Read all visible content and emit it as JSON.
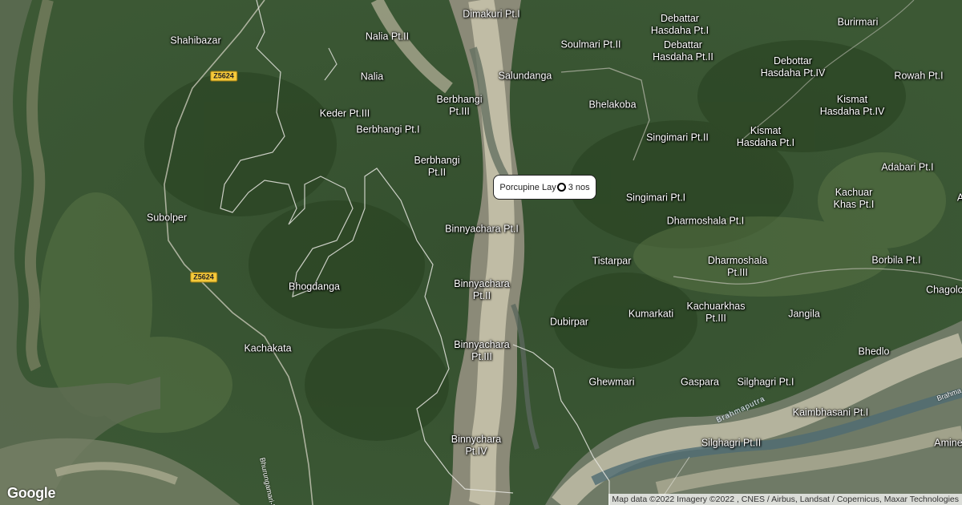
{
  "map": {
    "places": [
      {
        "key": "dimakuri",
        "label": "Dimakuri Pt.I"
      },
      {
        "key": "nalia_pt2",
        "label": "Nalia Pt.II"
      },
      {
        "key": "shahibazar",
        "label": "Shahibazar"
      },
      {
        "key": "soulmari",
        "label": "Soulmari Pt.II"
      },
      {
        "key": "debattar1",
        "label": "Debattar\nHasdaha Pt.I"
      },
      {
        "key": "debattar2",
        "label": "Debattar\nHasdaha Pt.II"
      },
      {
        "key": "burirmari",
        "label": "Burirmari"
      },
      {
        "key": "debottar4",
        "label": "Debottar\nHasdaha Pt.IV"
      },
      {
        "key": "nalia",
        "label": "Nalia"
      },
      {
        "key": "salundanga",
        "label": "Salundanga"
      },
      {
        "key": "rowah",
        "label": "Rowah Pt.I"
      },
      {
        "key": "bhelakoba",
        "label": "Bhelakoba"
      },
      {
        "key": "berbhangi3",
        "label": "Berbhangi\nPt.III"
      },
      {
        "key": "keder",
        "label": "Keder Pt.III"
      },
      {
        "key": "kismat4",
        "label": "Kismat\nHasdaha Pt.IV"
      },
      {
        "key": "berbhangi1",
        "label": "Berbhangi Pt.I"
      },
      {
        "key": "singimari2",
        "label": "Singimari Pt.II"
      },
      {
        "key": "kismat1",
        "label": "Kismat\nHasdaha Pt.I"
      },
      {
        "key": "berbhangi2",
        "label": "Berbhangi\nPt.II"
      },
      {
        "key": "adabari",
        "label": "Adabari Pt.I"
      },
      {
        "key": "singimari1",
        "label": "Singimari Pt.I"
      },
      {
        "key": "kachuar",
        "label": "Kachuar\nKhas Pt.I"
      },
      {
        "key": "subolper",
        "label": "Subolper"
      },
      {
        "key": "dharmoshala1",
        "label": "Dharmoshala Pt.I"
      },
      {
        "key": "binnyachara1",
        "label": "Binnyachara Pt.I"
      },
      {
        "key": "tistarpar",
        "label": "Tistarpar"
      },
      {
        "key": "dharmoshala3",
        "label": "Dharmoshala\nPt.III"
      },
      {
        "key": "borbila",
        "label": "Borbila Pt.I"
      },
      {
        "key": "chagolc",
        "label": "Chagolc"
      },
      {
        "key": "bhogdanga",
        "label": "Bhogdanga"
      },
      {
        "key": "binnyachara2",
        "label": "Binnyachara\nPt.II"
      },
      {
        "key": "kumarkati",
        "label": "Kumarkati"
      },
      {
        "key": "kachuarkhas3",
        "label": "Kachuarkhas\nPt.III"
      },
      {
        "key": "jangila",
        "label": "Jangila"
      },
      {
        "key": "dubirpar",
        "label": "Dubirpar"
      },
      {
        "key": "kachakata",
        "label": "Kachakata"
      },
      {
        "key": "binnyachara3",
        "label": "Binnyachara\nPt.III"
      },
      {
        "key": "bhedlo",
        "label": "Bhedlo"
      },
      {
        "key": "ghewmari",
        "label": "Ghewmari"
      },
      {
        "key": "gaspara",
        "label": "Gaspara"
      },
      {
        "key": "silghagri1",
        "label": "Silghagri Pt.I"
      },
      {
        "key": "kaimbhasani",
        "label": "Kaimbhasani Pt.I"
      },
      {
        "key": "binnychara4",
        "label": "Binnychara\nPt.IV"
      },
      {
        "key": "silghagri2",
        "label": "Silghagri Pt.II"
      },
      {
        "key": "amine",
        "label": "Amine"
      },
      {
        "key": "a_edge",
        "label": "A"
      }
    ],
    "road_shields": [
      "Z5624",
      "Z5624"
    ],
    "road_labels": {
      "bhurungamari": "Bhurungamari-Kach",
      "brahmaputra_edge": "Brahma"
    },
    "river_label": "Brahmaputra",
    "callout": {
      "text": "Porcupine Lay  3 nos",
      "left": "Porcupine Lay",
      "right": "3 nos",
      "marker_icon": "circle-marker-icon"
    },
    "google_logo": "Google",
    "attribution": "Map data ©2022 Imagery ©2022 , CNES / Airbus, Landsat / Copernicus, Maxar Technologies"
  }
}
